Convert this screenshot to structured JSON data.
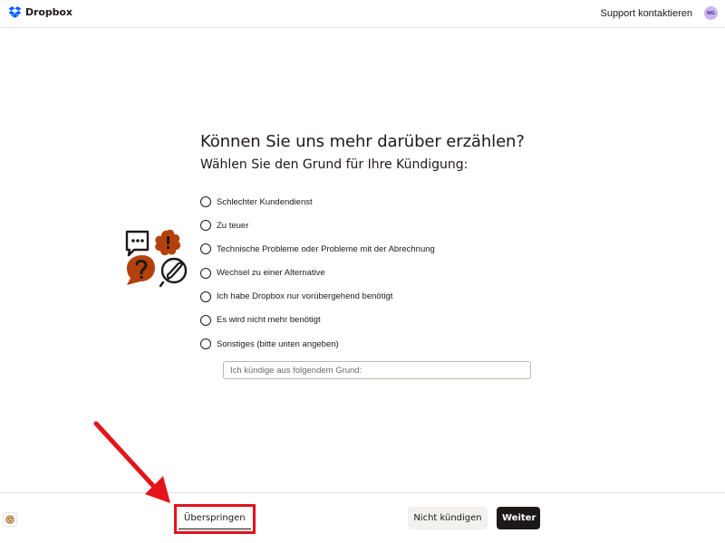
{
  "header": {
    "brand": "Dropbox",
    "support_link": "Support kontaktieren",
    "avatar_initials": "MG",
    "avatar_color": "#c9b3f0"
  },
  "main": {
    "title": "Können Sie uns mehr darüber erzählen?",
    "subtitle": "Wählen Sie den Grund für Ihre Kündigung:",
    "options": [
      {
        "label": "Schlechter Kundendienst",
        "selected": false
      },
      {
        "label": "Zu teuer",
        "selected": false
      },
      {
        "label": "Technische Probleme oder Probleme mit der Abrechnung",
        "selected": false
      },
      {
        "label": "Wechsel zu einer Alternative",
        "selected": false
      },
      {
        "label": "Ich habe Dropbox nur vorübergehend benötigt",
        "selected": false
      },
      {
        "label": "Es wird nicht mehr benötigt",
        "selected": false
      },
      {
        "label": "Sonstiges (bitte unten angeben)",
        "selected": false
      }
    ],
    "reason_input": {
      "placeholder": "Ich kündige aus folgendem Grund:",
      "value": ""
    }
  },
  "footer": {
    "skip_label": "Überspringen",
    "not_cancel_label": "Nicht kündigen",
    "continue_label": "Weiter"
  },
  "icons": {
    "logo": "dropbox-logo-icon",
    "illustration": "feedback-illustration-icon",
    "cookie": "cookie-icon",
    "annotation": "red-arrow-annotation"
  },
  "colors": {
    "brand_blue": "#0061fe",
    "illustration_orange": "#b4410c",
    "primary_button": "#1e1919",
    "secondary_button": "#f3f1ee",
    "annotation_red": "#e3141b"
  }
}
